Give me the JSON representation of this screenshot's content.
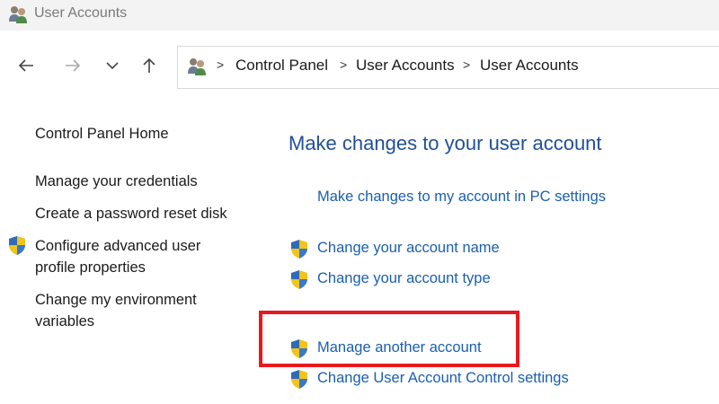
{
  "window": {
    "title": "User Accounts",
    "icon": "user-accounts-icon"
  },
  "nav": {
    "back_icon": "arrow-left-icon",
    "forward_icon": "arrow-right-icon",
    "recent_icon": "chevron-down-icon",
    "up_icon": "arrow-up-icon"
  },
  "address_bar": {
    "icon": "user-accounts-icon",
    "separator": ">",
    "crumbs": [
      "Control Panel",
      "User Accounts",
      "User Accounts"
    ]
  },
  "sidebar": {
    "home_link": "Control Panel Home",
    "links": [
      "Manage your credentials",
      "Create a password reset disk"
    ],
    "shield_link_line1": "Configure advanced user",
    "shield_link_line2": "profile properties",
    "env_link_line1": "Change my environment",
    "env_link_line2": "variables"
  },
  "main": {
    "heading": "Make changes to your user account",
    "pc_settings_link": "Make changes to my account in PC settings",
    "links": [
      "Change your account name",
      "Change your account type",
      "Manage another account",
      "Change User Account Control settings"
    ]
  },
  "colors": {
    "heading": "#1f4f9b",
    "link": "#1a5fb0",
    "highlight": "#e8191e",
    "titlebar": "#f3f3f3"
  }
}
